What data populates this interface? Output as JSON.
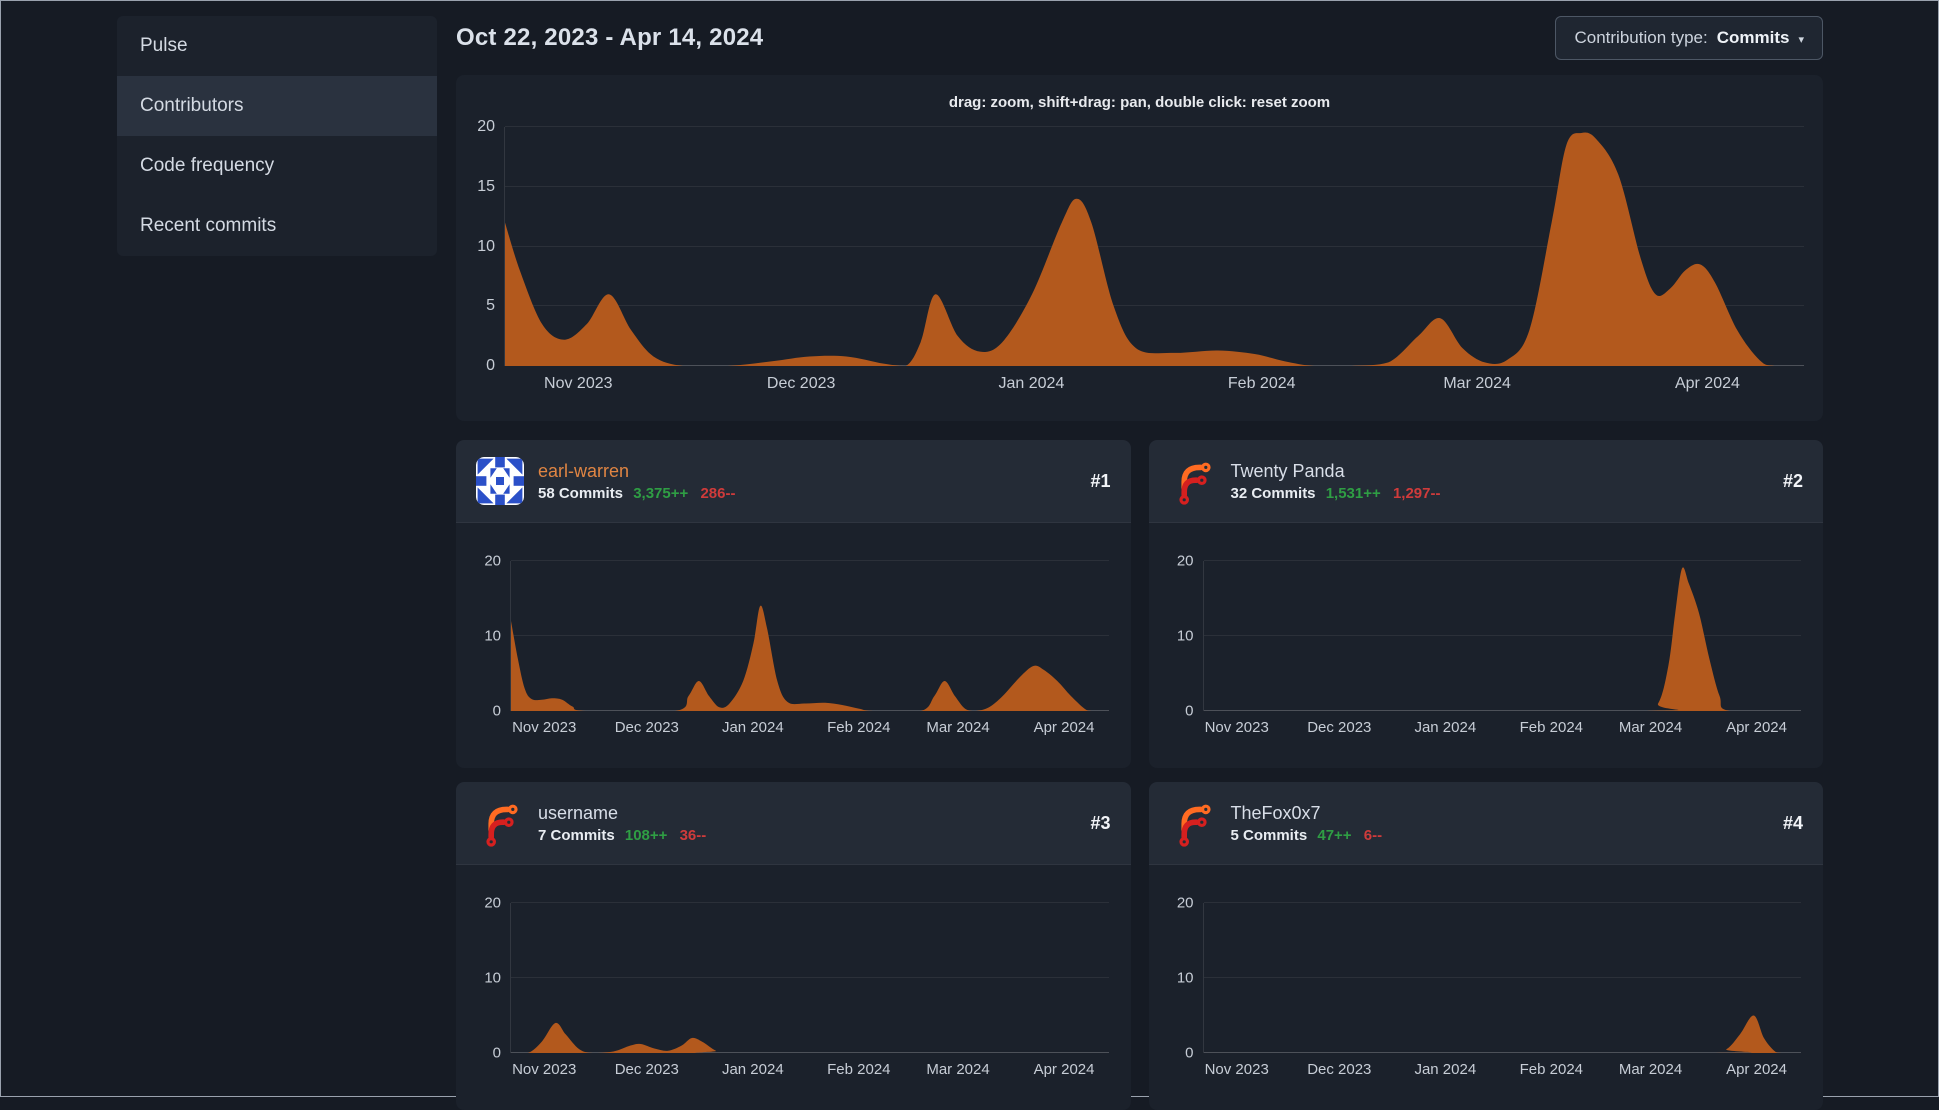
{
  "sidebar": {
    "items": [
      {
        "label": "Pulse",
        "active": false
      },
      {
        "label": "Contributors",
        "active": true
      },
      {
        "label": "Code frequency",
        "active": false
      },
      {
        "label": "Recent commits",
        "active": false
      }
    ]
  },
  "header": {
    "date_range": "Oct 22, 2023 - Apr 14, 2024",
    "contribution_type_label": "Contribution type:",
    "contribution_type_value": "Commits",
    "caret": "▾"
  },
  "main_chart": {
    "hint": "drag: zoom, shift+drag: pan, double click: reset zoom"
  },
  "contributors": [
    {
      "rank": "#1",
      "name": "earl-warren",
      "name_color": "#e08543",
      "commits": "58 Commits",
      "additions": "3,375++",
      "deletions": "286--",
      "avatar": "identicon-blue"
    },
    {
      "rank": "#2",
      "name": "Twenty Panda",
      "name_color": "#d8dee8",
      "commits": "32 Commits",
      "additions": "1,531++",
      "deletions": "1,297--",
      "avatar": "forgejo-logo"
    },
    {
      "rank": "#3",
      "name": "username",
      "name_color": "#d8dee8",
      "commits": "7 Commits",
      "additions": "108++",
      "deletions": "36--",
      "avatar": "forgejo-logo"
    },
    {
      "rank": "#4",
      "name": "TheFox0x7",
      "name_color": "#d8dee8",
      "commits": "5 Commits",
      "additions": "47++",
      "deletions": "6--",
      "avatar": "forgejo-logo"
    }
  ],
  "colors": {
    "chart_fill": "#b3591d",
    "additions_green": "#2f9e44",
    "deletions_red": "#cf3b3b",
    "link_orange": "#e08543",
    "identicon_blue": "#2b50c8",
    "forgejo_orange": "#ff6b22",
    "forgejo_red": "#d6201f"
  },
  "chart_data": [
    {
      "id": "overall",
      "type": "area",
      "title": "Commits over time (all contributors)",
      "x_unit": "days since Oct 22, 2023",
      "xmax": 175,
      "ymax": 20,
      "y_ticks": [
        0,
        5,
        10,
        15,
        20
      ],
      "x_ticks": [
        {
          "label": "Nov 2023",
          "day": 10
        },
        {
          "label": "Dec 2023",
          "day": 40
        },
        {
          "label": "Jan 2024",
          "day": 71
        },
        {
          "label": "Feb 2024",
          "day": 102
        },
        {
          "label": "Mar 2024",
          "day": 131
        },
        {
          "label": "Apr 2024",
          "day": 162
        }
      ],
      "points": [
        [
          0,
          12
        ],
        [
          2,
          8
        ],
        [
          5,
          3.5
        ],
        [
          8,
          2.2
        ],
        [
          11,
          3.5
        ],
        [
          14,
          6
        ],
        [
          17,
          3
        ],
        [
          20,
          0.8
        ],
        [
          24,
          0
        ],
        [
          30,
          0
        ],
        [
          36,
          0.4
        ],
        [
          41,
          0.8
        ],
        [
          46,
          0.8
        ],
        [
          51,
          0.2
        ],
        [
          54,
          0
        ],
        [
          56,
          2
        ],
        [
          58,
          6
        ],
        [
          61,
          2.5
        ],
        [
          64,
          1.2
        ],
        [
          67,
          2
        ],
        [
          71,
          6
        ],
        [
          75,
          12
        ],
        [
          77,
          14
        ],
        [
          79,
          12
        ],
        [
          82,
          5
        ],
        [
          85,
          1.5
        ],
        [
          90,
          1.1
        ],
        [
          96,
          1.3
        ],
        [
          101,
          1
        ],
        [
          105,
          0.4
        ],
        [
          109,
          0
        ],
        [
          114,
          0
        ],
        [
          119,
          0.3
        ],
        [
          123,
          2.5
        ],
        [
          126,
          4
        ],
        [
          129,
          1.5
        ],
        [
          132,
          0.3
        ],
        [
          135,
          0.5
        ],
        [
          138,
          3
        ],
        [
          141,
          12
        ],
        [
          143,
          18.5
        ],
        [
          145,
          19.5
        ],
        [
          147,
          19
        ],
        [
          150,
          16
        ],
        [
          153,
          9
        ],
        [
          155,
          6
        ],
        [
          157,
          6.5
        ],
        [
          159,
          8
        ],
        [
          161,
          8.5
        ],
        [
          163,
          7
        ],
        [
          166,
          3
        ],
        [
          169,
          0.5
        ],
        [
          171,
          0
        ],
        [
          175,
          0
        ]
      ]
    },
    {
      "id": "contributor-1",
      "type": "area",
      "title": "earl-warren commits",
      "x_unit": "days since Oct 22, 2023",
      "xmax": 175,
      "ymax": 20,
      "y_ticks": [
        0,
        10,
        20
      ],
      "x_ticks": [
        {
          "label": "Nov 2023",
          "day": 10
        },
        {
          "label": "Dec 2023",
          "day": 40
        },
        {
          "label": "Jan 2024",
          "day": 71
        },
        {
          "label": "Feb 2024",
          "day": 102
        },
        {
          "label": "Mar 2024",
          "day": 131
        },
        {
          "label": "Apr 2024",
          "day": 162
        }
      ],
      "points": [
        [
          0,
          12
        ],
        [
          2,
          7
        ],
        [
          4,
          3
        ],
        [
          6,
          1.6
        ],
        [
          9,
          1.5
        ],
        [
          12,
          1.7
        ],
        [
          15,
          1.5
        ],
        [
          18,
          0.6
        ],
        [
          22,
          0
        ],
        [
          48,
          0
        ],
        [
          52,
          2
        ],
        [
          55,
          4
        ],
        [
          58,
          2
        ],
        [
          61,
          0.5
        ],
        [
          64,
          1
        ],
        [
          68,
          4
        ],
        [
          71,
          9
        ],
        [
          73,
          14
        ],
        [
          75,
          11
        ],
        [
          78,
          4
        ],
        [
          81,
          1.2
        ],
        [
          86,
          1
        ],
        [
          92,
          1.1
        ],
        [
          97,
          0.8
        ],
        [
          102,
          0.3
        ],
        [
          106,
          0
        ],
        [
          120,
          0
        ],
        [
          124,
          2
        ],
        [
          127,
          4
        ],
        [
          130,
          2
        ],
        [
          133,
          0.3
        ],
        [
          136,
          0
        ],
        [
          140,
          0.5
        ],
        [
          144,
          2
        ],
        [
          149,
          4.5
        ],
        [
          153,
          6
        ],
        [
          156,
          5.5
        ],
        [
          160,
          4
        ],
        [
          164,
          2
        ],
        [
          168,
          0.3
        ],
        [
          170,
          0
        ],
        [
          175,
          0
        ]
      ]
    },
    {
      "id": "contributor-2",
      "type": "area",
      "title": "Twenty Panda commits",
      "x_unit": "days since Oct 22, 2023",
      "xmax": 175,
      "ymax": 20,
      "y_ticks": [
        0,
        10,
        20
      ],
      "x_ticks": [
        {
          "label": "Nov 2023",
          "day": 10
        },
        {
          "label": "Dec 2023",
          "day": 40
        },
        {
          "label": "Jan 2024",
          "day": 71
        },
        {
          "label": "Feb 2024",
          "day": 102
        },
        {
          "label": "Mar 2024",
          "day": 131
        },
        {
          "label": "Apr 2024",
          "day": 162
        }
      ],
      "points": [
        [
          0,
          0
        ],
        [
          128,
          0
        ],
        [
          133,
          1
        ],
        [
          136,
          6
        ],
        [
          138,
          13
        ],
        [
          140,
          19
        ],
        [
          142,
          17
        ],
        [
          145,
          13
        ],
        [
          148,
          7
        ],
        [
          151,
          2
        ],
        [
          154,
          0
        ],
        [
          175,
          0
        ]
      ]
    },
    {
      "id": "contributor-3",
      "type": "area",
      "title": "username commits",
      "x_unit": "days since Oct 22, 2023",
      "xmax": 175,
      "ymax": 20,
      "y_ticks": [
        0,
        10,
        20
      ],
      "x_ticks": [
        {
          "label": "Nov 2023",
          "day": 10
        },
        {
          "label": "Dec 2023",
          "day": 40
        },
        {
          "label": "Jan 2024",
          "day": 71
        },
        {
          "label": "Feb 2024",
          "day": 102
        },
        {
          "label": "Mar 2024",
          "day": 131
        },
        {
          "label": "Apr 2024",
          "day": 162
        }
      ],
      "points": [
        [
          0,
          0
        ],
        [
          5,
          0
        ],
        [
          9,
          1.5
        ],
        [
          13,
          4
        ],
        [
          16,
          2.5
        ],
        [
          20,
          0.5
        ],
        [
          24,
          0
        ],
        [
          30,
          0.2
        ],
        [
          35,
          1
        ],
        [
          38,
          1.2
        ],
        [
          42,
          0.6
        ],
        [
          46,
          0.3
        ],
        [
          50,
          1
        ],
        [
          53,
          2
        ],
        [
          56,
          1.5
        ],
        [
          60,
          0.3
        ],
        [
          63,
          0
        ],
        [
          175,
          0
        ]
      ]
    },
    {
      "id": "contributor-4",
      "type": "area",
      "title": "TheFox0x7 commits",
      "x_unit": "days since Oct 22, 2023",
      "xmax": 175,
      "ymax": 20,
      "y_ticks": [
        0,
        10,
        20
      ],
      "x_ticks": [
        {
          "label": "Nov 2023",
          "day": 10
        },
        {
          "label": "Dec 2023",
          "day": 40
        },
        {
          "label": "Jan 2024",
          "day": 71
        },
        {
          "label": "Feb 2024",
          "day": 102
        },
        {
          "label": "Mar 2024",
          "day": 131
        },
        {
          "label": "Apr 2024",
          "day": 162
        }
      ],
      "points": [
        [
          0,
          0
        ],
        [
          148,
          0
        ],
        [
          153,
          0.5
        ],
        [
          157,
          2.5
        ],
        [
          161,
          5
        ],
        [
          164,
          2
        ],
        [
          167,
          0.3
        ],
        [
          169,
          0
        ],
        [
          175,
          0
        ]
      ]
    }
  ]
}
